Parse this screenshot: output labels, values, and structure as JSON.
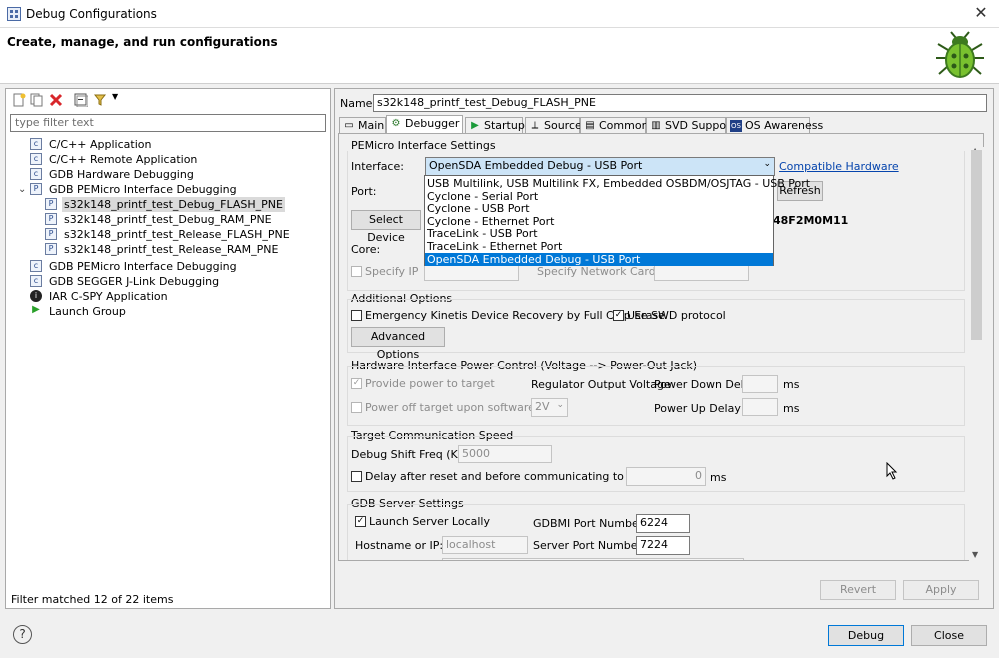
{
  "window": {
    "title": "Debug Configurations",
    "close_icon": "close-icon"
  },
  "header": {
    "title": "Create, manage, and run configurations"
  },
  "left": {
    "filter_placeholder": "type filter text",
    "tree": [
      {
        "label": "C/C++ Application",
        "icon": "c-app-icon"
      },
      {
        "label": "C/C++ Remote Application",
        "icon": "c-remote-icon"
      },
      {
        "label": "GDB Hardware Debugging",
        "icon": "c-hw-icon"
      },
      {
        "label": "GDB PEMicro Interface Debugging",
        "icon": "pemicro-icon",
        "expanded": true
      },
      {
        "label": "s32k148_printf_test_Debug_FLASH_PNE",
        "icon": "config-icon",
        "selected": true
      },
      {
        "label": "s32k148_printf_test_Debug_RAM_PNE",
        "icon": "config-icon"
      },
      {
        "label": "s32k148_printf_test_Release_FLASH_PNE",
        "icon": "config-icon"
      },
      {
        "label": "s32k148_printf_test_Release_RAM_PNE",
        "icon": "config-icon"
      },
      {
        "label": "GDB PEMicro Interface Debugging",
        "icon": "c-icon"
      },
      {
        "label": "GDB SEGGER J-Link Debugging",
        "icon": "c-icon"
      },
      {
        "label": "IAR C-SPY Application",
        "icon": "iar-icon"
      },
      {
        "label": "Launch Group",
        "icon": "launch-group-icon"
      }
    ],
    "filter_status": "Filter matched 12 of 22 items"
  },
  "right": {
    "name_label": "Name:",
    "name_value": "s32k148_printf_test_Debug_FLASH_PNE",
    "tabs": [
      "Main",
      "Debugger",
      "Startup",
      "Source",
      "Common",
      "SVD Support",
      "OS Awareness"
    ],
    "pemicro_title": "PEMicro Interface Settings",
    "interface_label": "Interface:",
    "interface_value": "OpenSDA Embedded Debug - USB Port",
    "compatible_link": "Compatible Hardware",
    "port_label": "Port:",
    "refresh": "Refresh",
    "select_device": "Select Device",
    "device_value": "48F2M0M11",
    "core_label": "Core:",
    "specify_ip": "Specify IP",
    "specify_netcard": "Specify Network Card IP",
    "dropdown": [
      "USB Multilink, USB Multilink FX, Embedded OSBDM/OSJTAG - USB Port",
      "Cyclone - Serial Port",
      "Cyclone - USB Port",
      "Cyclone - Ethernet Port",
      "TraceLink - USB Port",
      "TraceLink - Ethernet Port",
      "OpenSDA Embedded Debug - USB Port"
    ],
    "additional_title": "Additional Options",
    "emergency": "Emergency Kinetis Device Recovery by Full Chip Erase",
    "use_swd": "Use SWD protocol",
    "advanced": "Advanced Options",
    "power_title": "Hardware Interface Power Control (Voltage --> Power-Out Jack)",
    "provide_power": "Provide power to target",
    "regulator": "Regulator Output Voltage",
    "power_down": "Power Down Delay",
    "ms": "ms",
    "power_off": "Power off target upon software exit",
    "voltage": "2V",
    "power_up": "Power Up Delay",
    "target_title": "Target Communication Speed",
    "shift_freq": "Debug Shift Freq (KHz)",
    "shift_value": "5000",
    "delay_after": "Delay after reset and before communicating to target for",
    "delay_value": "0",
    "gdb_title": "GDB Server Settings",
    "launch_locally": "Launch Server Locally",
    "gdbmi_label": "GDBMI Port Number:",
    "gdbmi_value": "6224",
    "hostname_label": "Hostname or IP:",
    "hostname_value": "localhost",
    "server_port_label": "Server Port Number:",
    "server_port_value": "7224",
    "revert": "Revert",
    "apply": "Apply"
  },
  "footer": {
    "debug": "Debug",
    "close": "Close"
  }
}
